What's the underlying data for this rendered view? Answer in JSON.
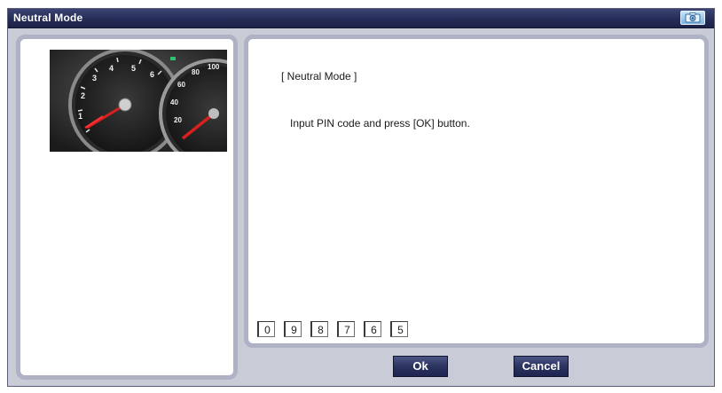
{
  "window": {
    "title": "Neutral Mode"
  },
  "content": {
    "heading": "[ Neutral Mode ]",
    "instruction": "Input PIN code and press [OK] button."
  },
  "pin": {
    "digits": [
      "0",
      "9",
      "8",
      "7",
      "6",
      "5"
    ]
  },
  "buttons": {
    "ok_label": "Ok",
    "cancel_label": "Cancel"
  },
  "icons": {
    "title_right": "camera-icon",
    "left_image": "instrument-cluster-gauge-icon"
  },
  "colors": {
    "titlebar": "#252c57",
    "button": "#2b335f",
    "panel_border": "#aeb2c4",
    "window_bg": "#c9cbd6"
  }
}
